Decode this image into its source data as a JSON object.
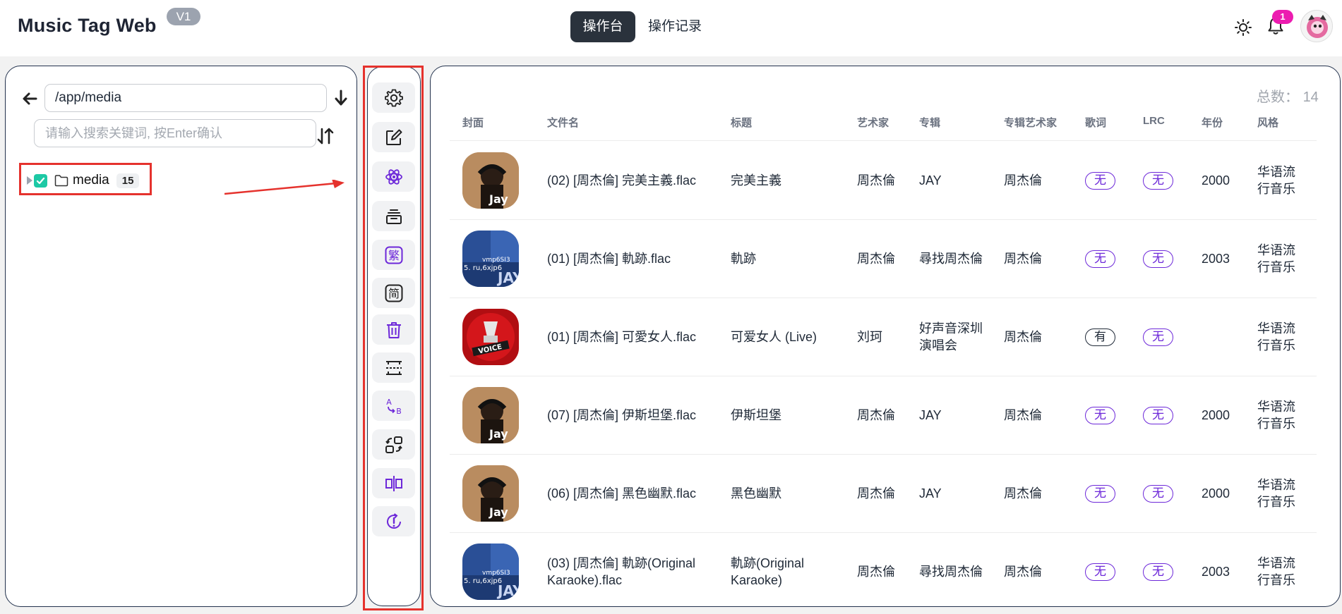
{
  "header": {
    "app_title": "Music Tag Web",
    "version": "V1",
    "tabs": [
      {
        "label": "操作台",
        "active": true
      },
      {
        "label": "操作记录",
        "active": false
      }
    ],
    "notification_count": "1"
  },
  "left_panel": {
    "path_value": "/app/media",
    "search_placeholder": "请输入搜索关键词, 按Enter确认",
    "tree": [
      {
        "label": "media",
        "count": "15",
        "checked": true
      }
    ]
  },
  "toolbar": {
    "tools": [
      {
        "icon": "gear-icon"
      },
      {
        "icon": "edit-icon"
      },
      {
        "icon": "atom-icon"
      },
      {
        "icon": "archive-icon"
      },
      {
        "icon": "traditional-chinese-icon",
        "glyph": "繁"
      },
      {
        "icon": "simplified-chinese-icon",
        "glyph": "简"
      },
      {
        "icon": "trash-icon"
      },
      {
        "icon": "spacing-icon"
      },
      {
        "icon": "rename-ab-icon",
        "glyph_a": "A",
        "glyph_b": "B"
      },
      {
        "icon": "swap-icon"
      },
      {
        "icon": "split-icon"
      },
      {
        "icon": "sync-alert-icon"
      }
    ]
  },
  "table": {
    "total_label": "总数：",
    "total_value": "14",
    "columns": [
      "封面",
      "文件名",
      "标题",
      "艺术家",
      "专辑",
      "专辑艺术家",
      "歌词",
      "LRC",
      "年份",
      "风格"
    ],
    "rows": [
      {
        "cover": "jay",
        "filename": "(02) [周杰倫] 完美主義.flac",
        "title": "完美主義",
        "artist": "周杰倫",
        "album": "JAY",
        "album_artist": "周杰倫",
        "lyrics": "无",
        "lrc": "无",
        "year": "2000",
        "genre": "华语流行音乐"
      },
      {
        "cover": "blue",
        "filename": "(01) [周杰倫] 軌跡.flac",
        "title": "軌跡",
        "artist": "周杰倫",
        "album": "尋找周杰倫",
        "album_artist": "周杰倫",
        "lyrics": "无",
        "lrc": "无",
        "year": "2003",
        "genre": "华语流行音乐"
      },
      {
        "cover": "voice",
        "filename": "(01) [周杰倫] 可愛女人.flac",
        "title": "可爱女人 (Live)",
        "artist": "刘珂",
        "album": "好声音深圳演唱会",
        "album_artist": "周杰倫",
        "lyrics": "有",
        "lrc": "无",
        "year": "",
        "genre": "华语流行音乐"
      },
      {
        "cover": "jay",
        "filename": "(07) [周杰倫] 伊斯坦堡.flac",
        "title": "伊斯坦堡",
        "artist": "周杰倫",
        "album": "JAY",
        "album_artist": "周杰倫",
        "lyrics": "无",
        "lrc": "无",
        "year": "2000",
        "genre": "华语流行音乐"
      },
      {
        "cover": "jay",
        "filename": "(06) [周杰倫] 黑色幽默.flac",
        "title": "黑色幽默",
        "artist": "周杰倫",
        "album": "JAY",
        "album_artist": "周杰倫",
        "lyrics": "无",
        "lrc": "无",
        "year": "2000",
        "genre": "华语流行音乐"
      },
      {
        "cover": "blue",
        "filename": "(03) [周杰倫] 軌跡(Original Karaoke).flac",
        "title": "軌跡(Original Karaoke)",
        "artist": "周杰倫",
        "album": "尋找周杰倫",
        "album_artist": "周杰倫",
        "lyrics": "无",
        "lrc": "无",
        "year": "2003",
        "genre": "华语流行音乐"
      }
    ]
  },
  "colors": {
    "accent_purple": "#6d28d9",
    "check_teal": "#1dc9a5",
    "badge_pink": "#ec1cb0",
    "highlight_red": "#e5322d",
    "active_tab": "#2a323c"
  }
}
